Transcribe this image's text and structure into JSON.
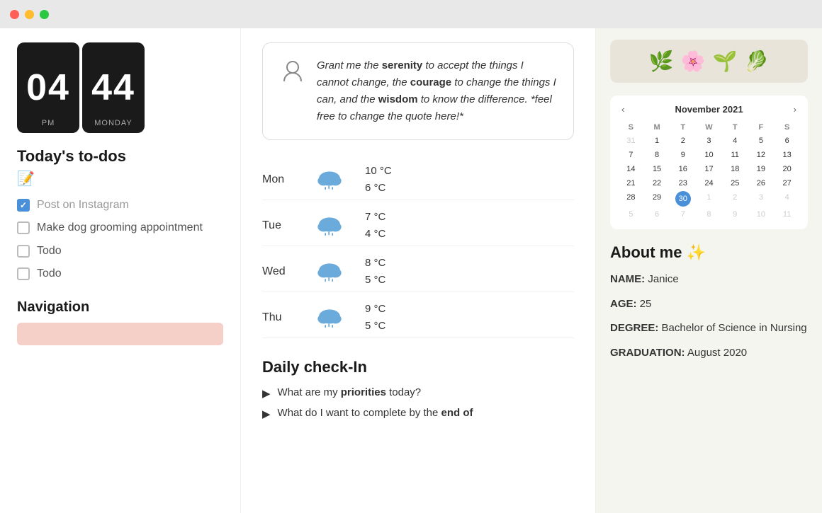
{
  "titleBar": {
    "lights": [
      "red",
      "yellow",
      "green"
    ]
  },
  "clock": {
    "hours": "04",
    "minutes": "44",
    "period": "PM",
    "day": "MONDAY"
  },
  "todos": {
    "sectionTitle": "Today's to-dos",
    "emoji": "📝",
    "items": [
      {
        "text": "Post on Instagram",
        "checked": true
      },
      {
        "text": "Make dog grooming appointment",
        "checked": false
      },
      {
        "text": "Todo",
        "checked": false
      },
      {
        "text": "Todo",
        "checked": false
      }
    ]
  },
  "navigation": {
    "title": "Navigation"
  },
  "quote": {
    "text": "Grant me the serenity to accept the things I cannot change, the courage to change the things I can, and the wisdom to know the difference. *feel free to change the quote here!*"
  },
  "weather": {
    "days": [
      {
        "day": "Mon",
        "high": "10 °C",
        "low": "6 °C"
      },
      {
        "day": "Tue",
        "high": "7 °C",
        "low": "4 °C"
      },
      {
        "day": "Wed",
        "high": "8 °C",
        "low": "5 °C"
      },
      {
        "day": "Thu",
        "high": "9 °C",
        "low": "5 °C"
      }
    ]
  },
  "checkIn": {
    "title": "Daily check-In",
    "items": [
      {
        "text": "What are my priorities today?"
      },
      {
        "text": "What do I want to complete by the end of"
      }
    ]
  },
  "plants": {
    "emojis": [
      "🌿",
      "🌸",
      "🌱",
      "🥬"
    ]
  },
  "calendar": {
    "month": "November 2021",
    "dayHeaders": [
      "S",
      "M",
      "T",
      "W",
      "T",
      "F",
      "S"
    ],
    "weeks": [
      [
        "31",
        "1",
        "2",
        "3",
        "4",
        "5",
        "6"
      ],
      [
        "7",
        "8",
        "9",
        "10",
        "11",
        "12",
        "13"
      ],
      [
        "14",
        "15",
        "16",
        "17",
        "18",
        "19",
        "20"
      ],
      [
        "21",
        "22",
        "23",
        "24",
        "25",
        "26",
        "27"
      ],
      [
        "28",
        "29",
        "30",
        "1",
        "2",
        "3",
        "4"
      ],
      [
        "5",
        "6",
        "7",
        "8",
        "9",
        "10",
        "11"
      ]
    ],
    "todayDate": "30",
    "prevIcon": "‹",
    "nextIcon": "›"
  },
  "aboutMe": {
    "title": "About me ✨",
    "fields": [
      {
        "label": "NAME",
        "value": "Janice"
      },
      {
        "label": "AGE",
        "value": "25"
      },
      {
        "label": "DEGREE",
        "value": "Bachelor of Science in Nursing"
      },
      {
        "label": "GRADUATION",
        "value": "August 2020"
      }
    ]
  }
}
